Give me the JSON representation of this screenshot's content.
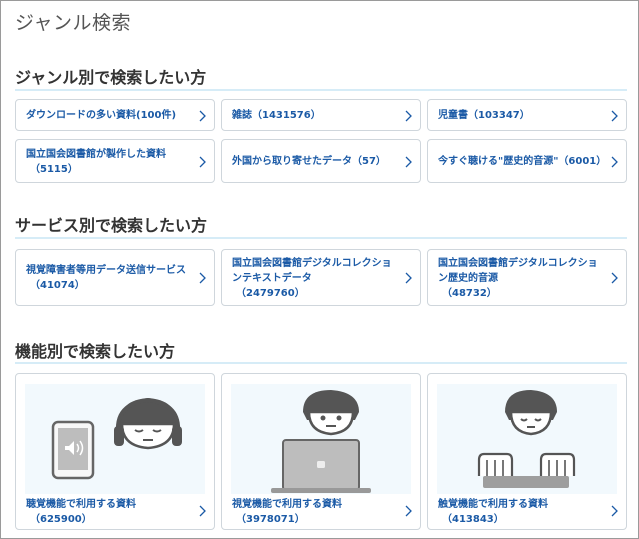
{
  "page_title": "ジャンル検索",
  "sections": {
    "genre": {
      "title": "ジャンル別で検索したい方",
      "items": [
        {
          "label": "ダウンロードの多い資料(100件)",
          "count": ""
        },
        {
          "label": "雑誌（1431576）",
          "count": ""
        },
        {
          "label": "児童書（103347）",
          "count": ""
        },
        {
          "label": "国立国会図書館が製作した資料",
          "count": "（5115）"
        },
        {
          "label": "外国から取り寄せたデータ（57）",
          "count": ""
        },
        {
          "label": "今すぐ聴ける\"歴史的音源\"（6001）",
          "count": ""
        }
      ]
    },
    "service": {
      "title": "サービス別で検索したい方",
      "items": [
        {
          "label": "視覚障害者等用データ送信サービス",
          "count": "（41074）"
        },
        {
          "label": "国立国会図書館デジタルコレクションテキストデータ",
          "count": "（2479760）"
        },
        {
          "label": "国立国会図書館デジタルコレクション歴史的音源",
          "count": "（48732）"
        }
      ]
    },
    "function": {
      "title": "機能別で検索したい方",
      "items": [
        {
          "label": "聴覚機能で利用する資料",
          "count": "（625900）",
          "illustration": "listening-person-with-tablet"
        },
        {
          "label": "視覚機能で利用する資料",
          "count": "（3978071）",
          "illustration": "person-with-laptop"
        },
        {
          "label": "触覚機能で利用する資料",
          "count": "（413843）",
          "illustration": "person-reading-braille"
        }
      ]
    }
  },
  "colors": {
    "link": "#1b5aa6",
    "rule": "#d6ecf7",
    "card_border": "#cfd6dc",
    "illustration_bg": "#f2f9fd",
    "figure_gray": "#555555"
  }
}
